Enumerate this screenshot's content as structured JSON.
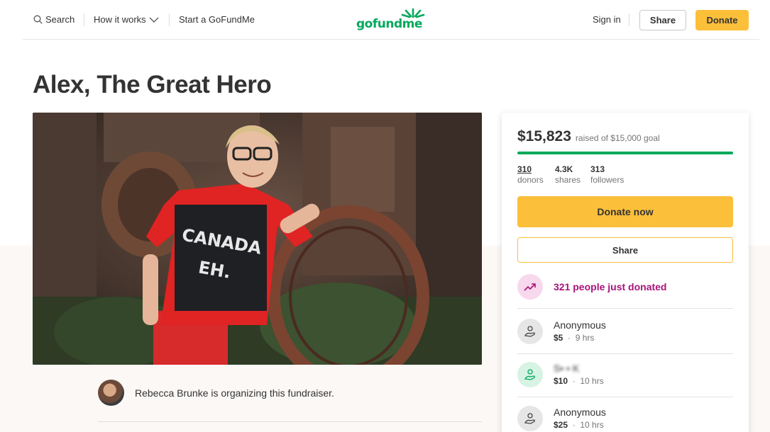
{
  "header": {
    "search_label": "Search",
    "how_it_works_label": "How it works",
    "start_label": "Start a GoFundMe",
    "logo_text": "gofundme",
    "sign_in_label": "Sign in",
    "share_label": "Share",
    "donate_label": "Donate"
  },
  "campaign": {
    "title": "Alex, The Great Hero",
    "hero_shirt_text_1": "CANADA",
    "hero_shirt_text_2": "EH.",
    "organizer_text": "Rebecca Brunke is organizing this fundraiser."
  },
  "card": {
    "amount_raised": "$15,823",
    "goal_text": "raised of $15,000 goal",
    "progress_fraction": 1.0,
    "stats": [
      {
        "value": "310",
        "label": "donors"
      },
      {
        "value": "4.3K",
        "label": "shares"
      },
      {
        "value": "313",
        "label": "followers"
      }
    ],
    "donate_now_label": "Donate now",
    "share_label": "Share",
    "trend_text": "321 people just donated",
    "donations": [
      {
        "name": "Anonymous",
        "amount": "$5",
        "time": "9 hrs"
      },
      {
        "name": "S• • K",
        "amount": "$10",
        "time": "10 hrs"
      },
      {
        "name": "Anonymous",
        "amount": "$25",
        "time": "10 hrs"
      }
    ]
  },
  "colors": {
    "brand_green": "#02a95c",
    "donate_yellow": "#fbbf3a",
    "trend_magenta": "#a8127a"
  }
}
